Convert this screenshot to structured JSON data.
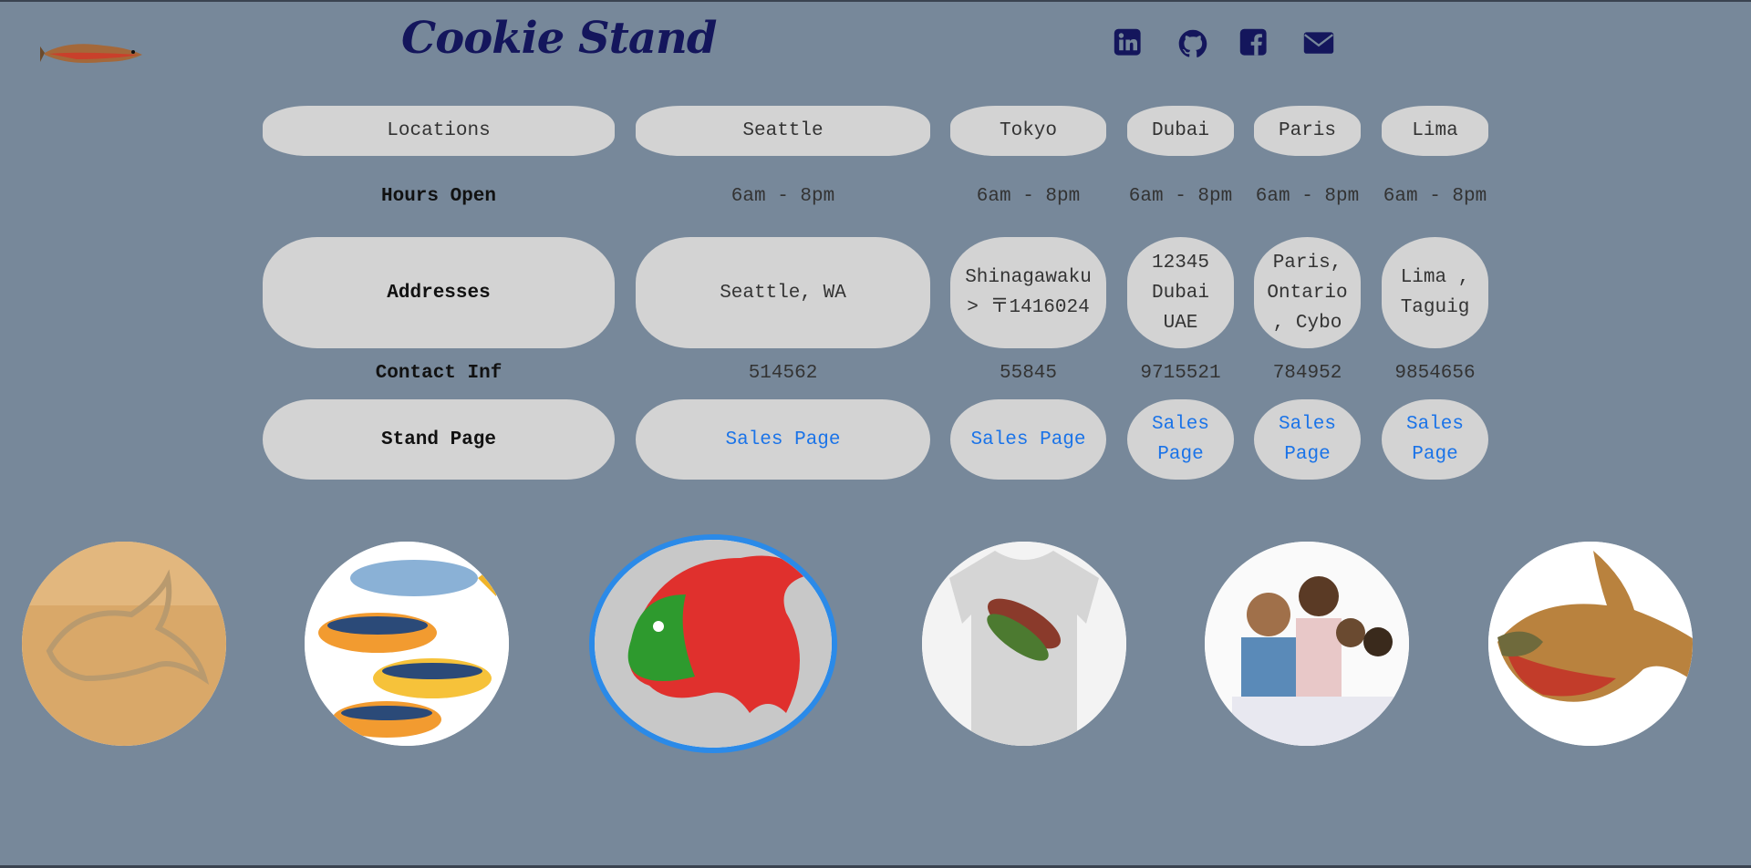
{
  "header": {
    "title": "Cookie Stand",
    "social": [
      "linkedin-icon",
      "github-icon",
      "facebook-icon",
      "envelope-icon"
    ]
  },
  "table": {
    "headers": [
      "Locations",
      "Seattle",
      "Tokyo",
      "Dubai",
      "Paris",
      "Lima"
    ],
    "hours": {
      "label": "Hours Open",
      "values": [
        "6am - 8pm",
        "6am - 8pm",
        "6am - 8pm",
        "6am - 8pm",
        "6am - 8pm"
      ]
    },
    "addresses": {
      "label": "Addresses",
      "values": [
        "Seattle, WA",
        "Shinagawaku > 〒1416024",
        "12345 Dubai UAE",
        "Paris, Ontario , Cybo",
        "Lima , Taguig"
      ]
    },
    "contact": {
      "label": "Contact Inf",
      "values": [
        "514562",
        "55845",
        "9715521",
        "784952",
        "9854656"
      ]
    },
    "stand": {
      "label": "Stand Page",
      "link_label": "Sales Page"
    }
  },
  "gallery": [
    "fish-cookie-cutter-image",
    "decorated-fish-cookies-image",
    "red-salmon-cookie-image",
    "salmon-tshirt-image",
    "family-image",
    "salmon-image"
  ],
  "colors": {
    "background": "#77889a",
    "title": "#14165c",
    "pill": "#d3d3d3",
    "link": "#1a73e8",
    "active_ring": "#2b8ae8"
  }
}
